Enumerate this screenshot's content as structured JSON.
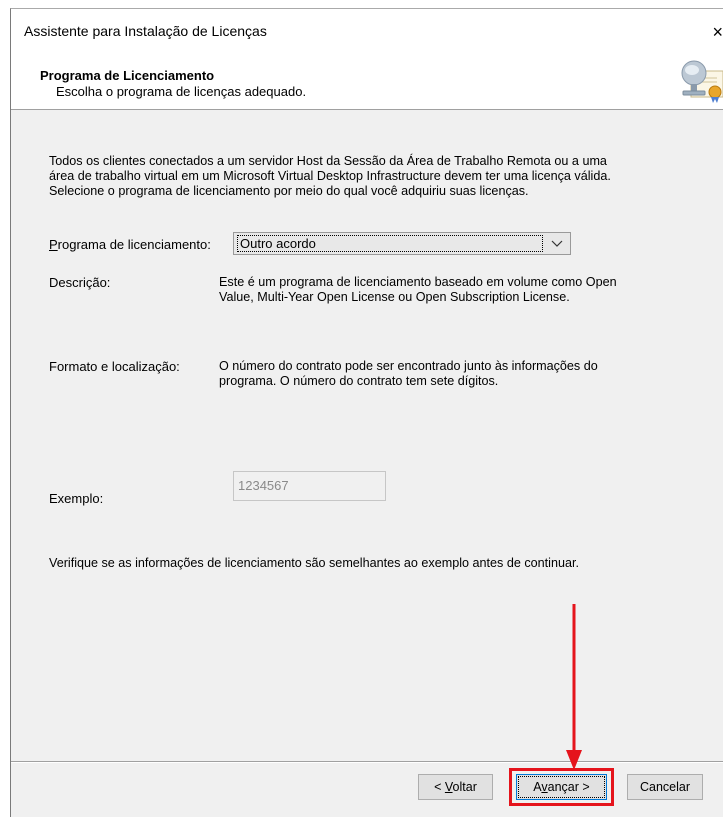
{
  "window": {
    "title": "Assistente para Instalação de Licenças",
    "close_icon": "×"
  },
  "header": {
    "title": "Programa de Licenciamento",
    "subtitle": "Escolha o programa de licenças adequado.",
    "icon": "certificate-icon"
  },
  "intro_text": "Todos os clientes conectados a um servidor Host da Sessão da Área de Trabalho Remota ou a uma área de trabalho virtual em um Microsoft Virtual Desktop Infrastructure devem ter uma licença válida. Selecione o programa de licenciamento por meio do qual você adquiriu suas licenças.",
  "program": {
    "label_accesskey": "P",
    "label_rest": "rograma de licenciamento:",
    "selected": "Outro acordo"
  },
  "description": {
    "label": "Descrição:",
    "text": "Este é um programa de licenciamento baseado em volume como Open Value, Multi-Year Open License ou Open Subscription License."
  },
  "format": {
    "label": "Formato e localização:",
    "text": "O número do contrato pode ser encontrado junto às informações do programa. O número do contrato tem sete dígitos."
  },
  "example": {
    "label": "Exemplo:",
    "value": "1234567"
  },
  "verify_text": "Verifique se as informações de licenciamento são semelhantes ao exemplo antes de continuar.",
  "buttons": {
    "back_prefix": "< ",
    "back_accesskey": "V",
    "back_rest": "oltar",
    "next_prefix": "A",
    "next_accesskey": "v",
    "next_rest": "ançar >",
    "cancel": "Cancelar"
  },
  "annotation_color": "#e5141c"
}
